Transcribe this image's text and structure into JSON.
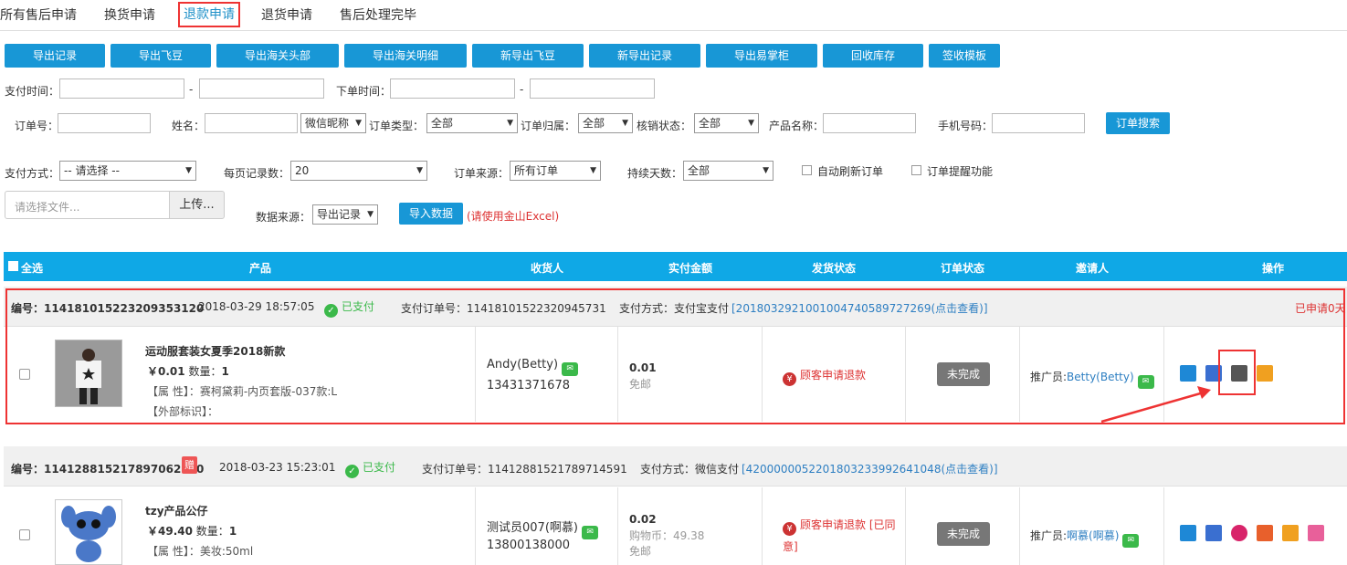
{
  "tabs": [
    "所有售后申请",
    "换货申请",
    "退款申请",
    "退货申请",
    "售后处理完毕"
  ],
  "toolbar_buttons": [
    "导出记录",
    "导出飞豆",
    "导出海关头部",
    "导出海关明细",
    "新导出飞豆",
    "新导出记录",
    "导出易掌柜",
    "回收库存",
    "签收模板"
  ],
  "filters": {
    "pay_time_label": "支付时间：",
    "order_time_label": "下单时间：",
    "dash": "-",
    "order_no_label": "订单号：",
    "name_label": "姓名：",
    "wechat_select": "微信昵称",
    "order_type_label": "订单类型：",
    "order_type_value": "全部",
    "order_owner_label": "订单归属：",
    "order_owner_value": "全部",
    "verify_label": "核销状态：",
    "verify_value": "全部",
    "product_name_label": "产品名称：",
    "phone_label": "手机号码：",
    "search_button": "订单搜索",
    "pay_method_label": "支付方式：",
    "pay_method_value": "-- 请选择 --",
    "per_page_label": "每页记录数：",
    "per_page_value": "20",
    "order_source_label": "订单来源：",
    "order_source_value": "所有订单",
    "duration_label": "持续天数：",
    "duration_value": "全部",
    "auto_refresh_label": "自动刷新订单",
    "remind_label": "订单提醒功能",
    "file_placeholder": "请选择文件...",
    "upload_button": "上传...",
    "data_source_label": "数据来源：",
    "data_source_value": "导出记录",
    "import_button": "导入数据",
    "import_hint": "(请使用金山Excel)"
  },
  "table_header": {
    "select_all": "全选",
    "product": "产品",
    "receiver": "收货人",
    "paid": "实付金额",
    "ship": "发货状态",
    "status": "订单状态",
    "inviter": "邀请人",
    "ops": "操作"
  },
  "orders": [
    {
      "no_label": "编号：",
      "no": "114181015223209353120",
      "time": "2018-03-29 18:57:05",
      "paid_status": "已支付",
      "pay_no_label": "支付订单号：",
      "pay_no": "11418101522320945731",
      "pay_method_label": "支付方式：",
      "pay_method": "支付宝支付",
      "pay_ref": "[2018032921001004740589727269(点击查看)]",
      "applied": "已申请0天",
      "product_title": "运动服套装女夏季2018新款",
      "price": "￥0.01",
      "qty_label": "数量：",
      "qty": "1",
      "attr_label": "【属 性】：",
      "attr": "赛柯黛莉-内页套版-037款:L",
      "ext_label": "【外部标识】：",
      "receiver": "Andy(Betty)",
      "phone": "13431371678",
      "amount": "0.01",
      "shipping": "免邮",
      "refund_status": "顾客申请退款",
      "order_status": "未完成",
      "promoter_label": "推广员:",
      "promoter": "Betty(Betty)"
    },
    {
      "no_label": "编号：",
      "no": "114128815217897062590",
      "gift": "赠",
      "time": "2018-03-23 15:23:01",
      "paid_status": "已支付",
      "pay_no_label": "支付订单号：",
      "pay_no": "11412881521789714591",
      "pay_method_label": "支付方式：",
      "pay_method": "微信支付",
      "pay_ref": "[4200000052201803233992641048(点击查看)]",
      "product_title": "tzy产品公仔",
      "price": "￥49.40",
      "qty_label": "数量：",
      "qty": "1",
      "attr_label": "【属 性】：",
      "attr": "美妆:50ml",
      "receiver": "测试员007(啊慕)",
      "phone": "13800138000",
      "amount": "0.02",
      "coin": "购物币：49.38",
      "shipping": "免邮",
      "refund_status_1": "顾客申请退款 [已同",
      "refund_status_2": "意]",
      "order_status": "未完成",
      "promoter_label": "推广员:",
      "promoter": "啊慕(啊慕)"
    }
  ],
  "colors": {
    "accent": "#1897d6",
    "header": "#0fa8e6",
    "highlight": "#e33333",
    "paid": "#3bb94a"
  }
}
